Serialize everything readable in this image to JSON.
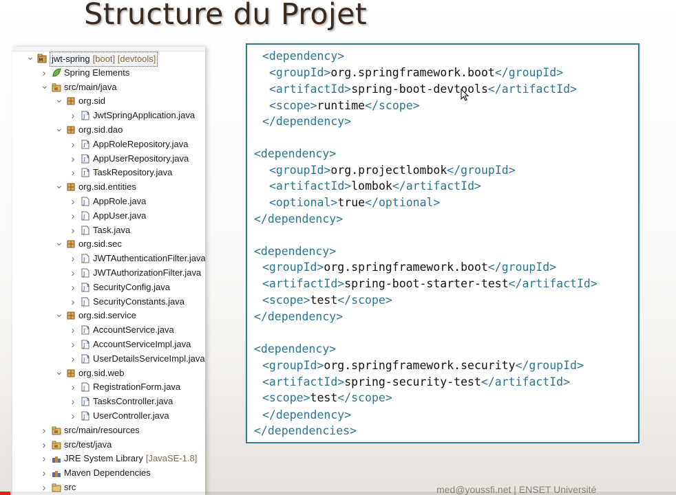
{
  "slide": {
    "title": "Structure du Projet",
    "footer": "med@youssfi.net | ENSET Université"
  },
  "video": {
    "progress": 0.015,
    "progress_color": "#e02020"
  },
  "colors": {
    "tag": "#2b7592",
    "text": "#111111",
    "border": "#2f7a8e",
    "title": "#3a2a1f"
  },
  "tree": {
    "project": {
      "name": "jwt-spring",
      "decorators": "[boot] [devtools]"
    },
    "items": [
      {
        "label": "jwt-spring",
        "icon": "project-icon",
        "expanded": true,
        "decor": "[boot] [devtools]",
        "selected": true
      },
      {
        "label": "Spring Elements",
        "icon": "spring-leaf-icon",
        "expanded": false
      },
      {
        "label": "src/main/java",
        "icon": "source-folder-icon",
        "expanded": true
      },
      {
        "label": "org.sid",
        "icon": "package-icon",
        "expanded": true
      },
      {
        "label": "JwtSpringApplication.java",
        "icon": "spring-java-file-icon",
        "expanded": false
      },
      {
        "label": "org.sid.dao",
        "icon": "package-icon",
        "expanded": true
      },
      {
        "label": "AppRoleRepository.java",
        "icon": "interface-file-icon",
        "expanded": false
      },
      {
        "label": "AppUserRepository.java",
        "icon": "interface-file-icon",
        "expanded": false
      },
      {
        "label": "TaskRepository.java",
        "icon": "interface-file-icon",
        "expanded": false
      },
      {
        "label": "org.sid.entities",
        "icon": "package-icon",
        "expanded": true
      },
      {
        "label": "AppRole.java",
        "icon": "java-file-icon",
        "expanded": false
      },
      {
        "label": "AppUser.java",
        "icon": "java-file-icon",
        "expanded": false
      },
      {
        "label": "Task.java",
        "icon": "java-file-icon",
        "expanded": false
      },
      {
        "label": "org.sid.sec",
        "icon": "package-icon",
        "expanded": true
      },
      {
        "label": "JWTAuthenticationFilter.java",
        "icon": "java-file-icon",
        "expanded": false
      },
      {
        "label": "JWTAuthorizationFilter.java",
        "icon": "java-file-icon",
        "expanded": false
      },
      {
        "label": "SecurityConfig.java",
        "icon": "spring-java-file-icon",
        "expanded": false
      },
      {
        "label": "SecurityConstants.java",
        "icon": "java-file-icon",
        "expanded": false
      },
      {
        "label": "org.sid.service",
        "icon": "package-icon",
        "expanded": true
      },
      {
        "label": "AccountService.java",
        "icon": "interface-file-icon",
        "expanded": false
      },
      {
        "label": "AccountServiceImpl.java",
        "icon": "spring-java-file-icon",
        "expanded": false
      },
      {
        "label": "UserDetailsServiceImpl.java",
        "icon": "spring-java-file-icon",
        "expanded": false
      },
      {
        "label": "org.sid.web",
        "icon": "package-icon",
        "expanded": true
      },
      {
        "label": "RegistrationForm.java",
        "icon": "java-file-icon",
        "expanded": false
      },
      {
        "label": "TasksController.java",
        "icon": "spring-java-file-icon",
        "expanded": false
      },
      {
        "label": "UserController.java",
        "icon": "spring-java-file-icon",
        "expanded": false
      },
      {
        "label": "src/main/resources",
        "icon": "source-folder-icon",
        "expanded": false
      },
      {
        "label": "src/test/java",
        "icon": "source-folder-icon",
        "expanded": false
      },
      {
        "label": "JRE System Library",
        "icon": "library-icon",
        "expanded": false,
        "decor": "[JavaSE-1.8]"
      },
      {
        "label": "Maven Dependencies",
        "icon": "library-icon",
        "expanded": false
      },
      {
        "label": "src",
        "icon": "folder-icon",
        "expanded": false
      }
    ]
  },
  "code": {
    "lines": [
      {
        "tokens": [
          {
            "t": "<dependency>",
            "k": "tag"
          }
        ]
      },
      {
        "tokens": [
          {
            "t": "<groupId>",
            "k": "tag"
          },
          {
            "t": "org.springframework.boot",
            "k": "val"
          },
          {
            "t": "</groupId>",
            "k": "tag"
          }
        ]
      },
      {
        "tokens": [
          {
            "t": "<artifactId>",
            "k": "tag"
          },
          {
            "t": "spring-boot-devtools",
            "k": "val"
          },
          {
            "t": "</artifactId>",
            "k": "tag"
          }
        ]
      },
      {
        "tokens": [
          {
            "t": "<scope>",
            "k": "tag"
          },
          {
            "t": "runtime",
            "k": "val"
          },
          {
            "t": "</scope>",
            "k": "tag"
          }
        ]
      },
      {
        "tokens": [
          {
            "t": "</dependency>",
            "k": "tag"
          }
        ]
      },
      {
        "tokens": [
          {
            "t": "<dependency>",
            "k": "tag"
          }
        ]
      },
      {
        "tokens": [
          {
            "t": "<groupId>",
            "k": "tag"
          },
          {
            "t": "org.projectlombok",
            "k": "val"
          },
          {
            "t": "</groupId>",
            "k": "tag"
          }
        ]
      },
      {
        "tokens": [
          {
            "t": "<artifactId>",
            "k": "tag"
          },
          {
            "t": "lombok",
            "k": "val"
          },
          {
            "t": "</artifactId>",
            "k": "tag"
          }
        ]
      },
      {
        "tokens": [
          {
            "t": "<optional>",
            "k": "tag"
          },
          {
            "t": "true",
            "k": "val"
          },
          {
            "t": "</optional>",
            "k": "tag"
          }
        ]
      },
      {
        "tokens": [
          {
            "t": "</dependency>",
            "k": "tag"
          }
        ]
      },
      {
        "tokens": [
          {
            "t": "<dependency>",
            "k": "tag"
          }
        ]
      },
      {
        "tokens": [
          {
            "t": "<groupId>",
            "k": "tag"
          },
          {
            "t": "org.springframework.boot",
            "k": "val"
          },
          {
            "t": "</groupId>",
            "k": "tag"
          }
        ]
      },
      {
        "tokens": [
          {
            "t": "<artifactId>",
            "k": "tag"
          },
          {
            "t": "spring-boot-starter-test",
            "k": "val"
          },
          {
            "t": "</artifactId>",
            "k": "tag"
          }
        ]
      },
      {
        "tokens": [
          {
            "t": "<scope>",
            "k": "tag"
          },
          {
            "t": "test",
            "k": "val"
          },
          {
            "t": "</scope>",
            "k": "tag"
          }
        ]
      },
      {
        "tokens": [
          {
            "t": "</dependency>",
            "k": "tag"
          }
        ]
      },
      {
        "tokens": [
          {
            "t": "<dependency>",
            "k": "tag"
          }
        ]
      },
      {
        "tokens": [
          {
            "t": "<groupId>",
            "k": "tag"
          },
          {
            "t": "org.springframework.security",
            "k": "val"
          },
          {
            "t": "</groupId>",
            "k": "tag"
          }
        ]
      },
      {
        "tokens": [
          {
            "t": "<artifactId>",
            "k": "tag"
          },
          {
            "t": "spring-security-test",
            "k": "val"
          },
          {
            "t": "</artifactId>",
            "k": "tag"
          }
        ]
      },
      {
        "tokens": [
          {
            "t": "<scope>",
            "k": "tag"
          },
          {
            "t": "test",
            "k": "val"
          },
          {
            "t": "</scope>",
            "k": "tag"
          }
        ]
      },
      {
        "tokens": [
          {
            "t": "</dependency>",
            "k": "tag"
          }
        ]
      },
      {
        "tokens": [
          {
            "t": "</dependencies>",
            "k": "tag"
          }
        ]
      }
    ]
  }
}
